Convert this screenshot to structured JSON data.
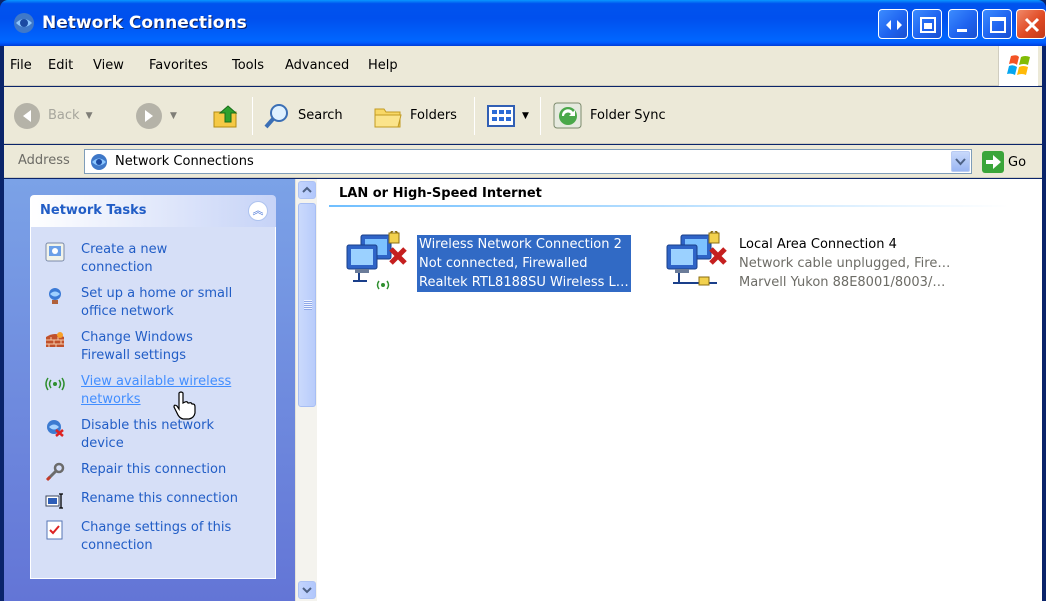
{
  "window": {
    "title": "Network Connections"
  },
  "menu": {
    "items": [
      "File",
      "Edit",
      "View",
      "Favorites",
      "Tools",
      "Advanced",
      "Help"
    ]
  },
  "toolbar": {
    "back_label": "Back",
    "search_label": "Search",
    "folders_label": "Folders",
    "folder_sync_label": "Folder Sync"
  },
  "address": {
    "label": "Address",
    "value": "Network Connections",
    "go_label": "Go"
  },
  "tasks": {
    "title": "Network Tasks",
    "items": [
      {
        "line1": "Create a new",
        "line2": "connection",
        "icon": "new-connection-icon"
      },
      {
        "line1": "Set up a home or small",
        "line2": "office network",
        "icon": "home-network-icon"
      },
      {
        "line1": "Change Windows",
        "line2": "Firewall settings",
        "icon": "firewall-icon"
      },
      {
        "line1": "View available wireless",
        "line2": "networks",
        "icon": "wireless-icon"
      },
      {
        "line1": "Disable this network",
        "line2": "device",
        "icon": "disable-device-icon"
      },
      {
        "line1": "Repair this connection",
        "line2": "",
        "icon": "repair-icon"
      },
      {
        "line1": "Rename this connection",
        "line2": "",
        "icon": "rename-icon"
      },
      {
        "line1": "Change settings of this",
        "line2": "connection",
        "icon": "settings-icon"
      }
    ]
  },
  "content": {
    "group_title": "LAN or High-Speed Internet",
    "connections": [
      {
        "name": "Wireless Network Connection 2",
        "status": "Not connected, Firewalled",
        "device": "Realtek RTL8188SU Wireless L…",
        "selected": true
      },
      {
        "name": "Local Area Connection 4",
        "status": "Network cable unplugged, Fire…",
        "device": "Marvell Yukon 88E8001/8003/…",
        "selected": false
      }
    ]
  },
  "colors": {
    "selection": "#316ac5",
    "task_link": "#215dc6",
    "task_pane_bg": "#d6dff7"
  }
}
